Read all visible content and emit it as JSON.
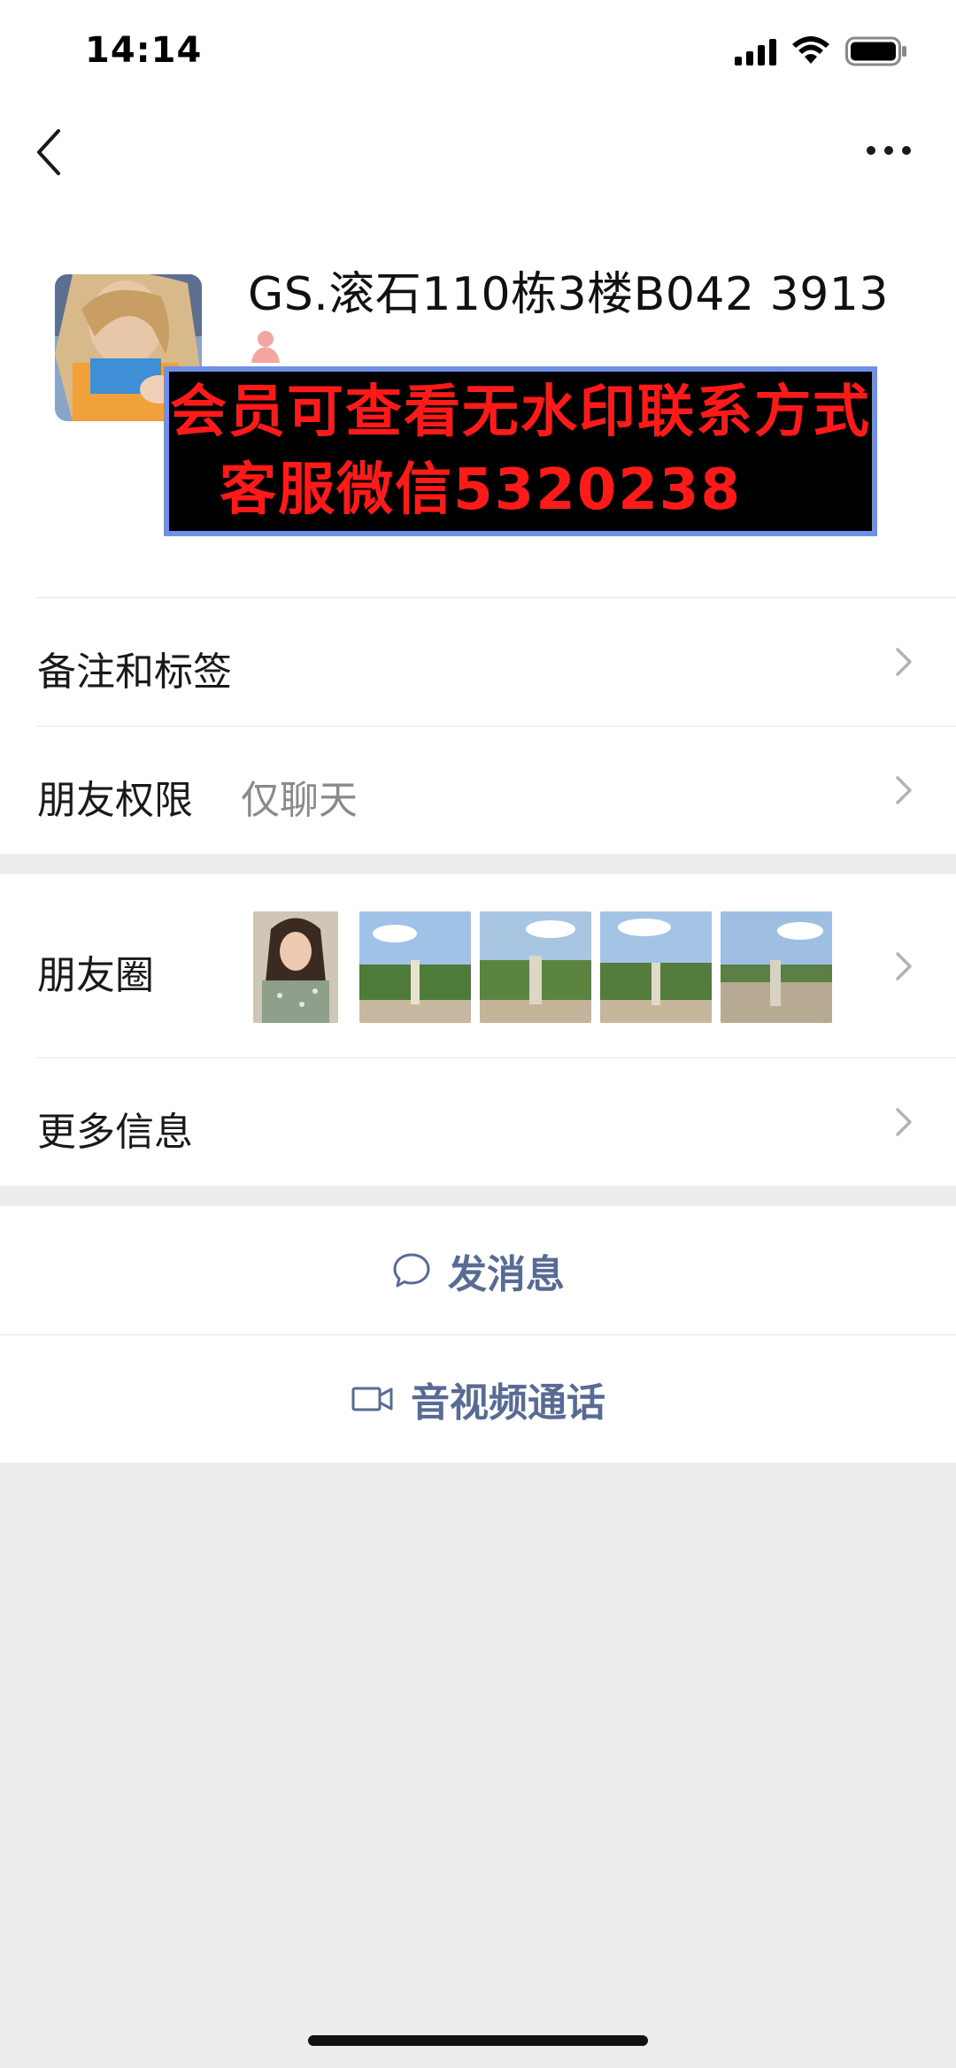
{
  "status_bar": {
    "time": "14:14"
  },
  "icons": {
    "back": "chevron-left-icon",
    "more": "more-horizontal-icon",
    "gender": "female-icon",
    "chevron": "chevron-right-icon",
    "message": "chat-bubble-icon",
    "video": "video-camera-icon"
  },
  "profile": {
    "name": "GS.滚石110栋3楼B042 3913"
  },
  "watermark": {
    "line1": "会员可查看无水印联系方式",
    "line2": "客服微信5320238"
  },
  "rows": {
    "remarks": {
      "label": "备注和标签"
    },
    "permissions": {
      "label": "朋友权限",
      "value": "仅聊天"
    },
    "moments": {
      "label": "朋友圈"
    },
    "more_info": {
      "label": "更多信息"
    }
  },
  "actions": {
    "message": "发消息",
    "call": "音视频通话"
  },
  "colors": {
    "link_blue": "#576b95",
    "background_gray": "#ededed",
    "watermark_red": "#ff1a1a",
    "watermark_border": "#6f8fe8"
  }
}
